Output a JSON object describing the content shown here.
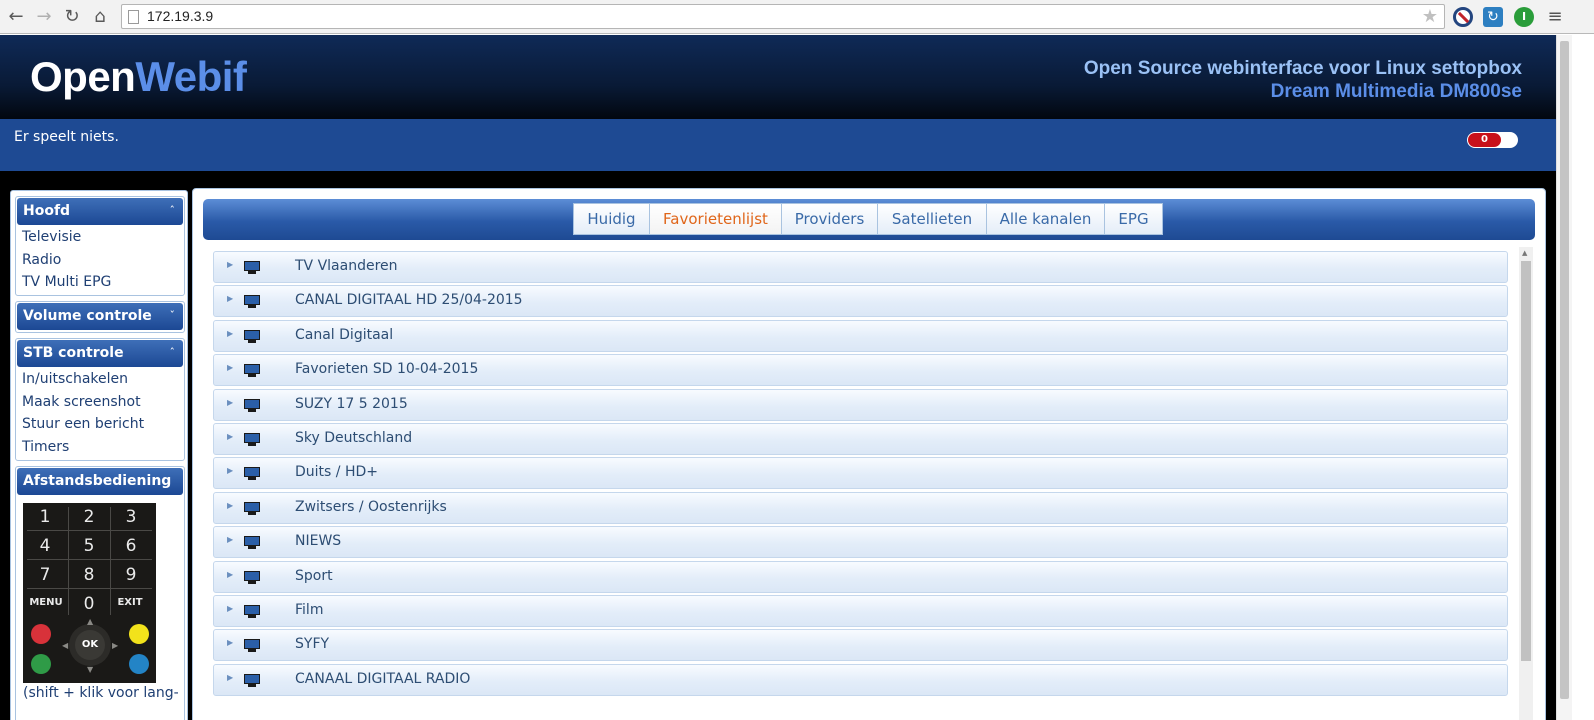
{
  "browser": {
    "url": "172.19.3.9"
  },
  "header": {
    "logo_part1": "Open",
    "logo_part2": "Webif",
    "tagline_line1": "Open Source webinterface voor Linux settopbox",
    "tagline_line2": "Dream Multimedia DM800se"
  },
  "status": {
    "text": "Er speelt niets.",
    "toggle_value": "0"
  },
  "sidebar": {
    "hoofd": {
      "title": "Hoofd",
      "items": [
        "Televisie",
        "Radio",
        "TV Multi EPG"
      ]
    },
    "volume": {
      "title": "Volume controle"
    },
    "stb": {
      "title": "STB controle",
      "items": [
        "In/uitschakelen",
        "Maak screenshot",
        "Stuur een bericht",
        "Timers"
      ]
    },
    "remote": {
      "title": "Afstandsbediening",
      "keys": [
        "1",
        "2",
        "3",
        "4",
        "5",
        "6",
        "7",
        "8",
        "9",
        "MENU",
        "0",
        "EXIT"
      ],
      "ok": "OK",
      "colors": {
        "red": "#d8323a",
        "yellow": "#f2e21b",
        "green": "#2f9b47",
        "blue": "#2384c6"
      },
      "hint": "(shift + klik voor lang-"
    }
  },
  "tabs": [
    "Huidig",
    "Favorietenlijst",
    "Providers",
    "Satellieten",
    "Alle kanalen",
    "EPG"
  ],
  "active_tab": "Favorietenlijst",
  "bouquets": [
    "TV Vlaanderen",
    "CANAL DIGITAAL HD 25/04-2015",
    "Canal Digitaal",
    "Favorieten SD 10-04-2015",
    "SUZY 17 5 2015",
    "Sky Deutschland",
    "Duits / HD+",
    "Zwitsers / Oostenrijks",
    "NIEWS",
    "Sport",
    "Film",
    "SYFY",
    "CANAAL DIGITAAL RADIO"
  ],
  "colors": {
    "header_dark": "#091a36",
    "statusbar": "#1e4a93",
    "accent_blue": "#5b8ee8",
    "active_tab": "#e0661a"
  }
}
